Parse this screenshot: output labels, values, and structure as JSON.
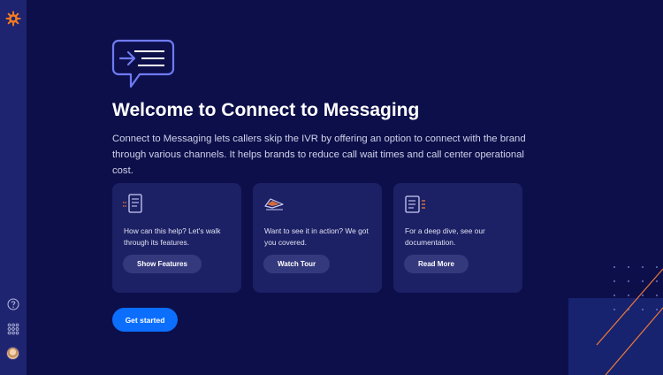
{
  "sidebar": {
    "logo_icon": "sun-gear-logo",
    "help_icon": "question-circle-icon",
    "apps_icon": "app-grid-icon",
    "avatar": "user-avatar"
  },
  "hero": {
    "icon": "chat-arrow-icon",
    "title": "Welcome to Connect to Messaging",
    "description": "Connect to Messaging lets callers skip the IVR by offering an option to connect with the brand through various channels. It helps brands to reduce call wait times and call center operational cost."
  },
  "cards": [
    {
      "icon": "feature-list-icon",
      "text": "How can this help? Let's walk through its features.",
      "button": "Show Features"
    },
    {
      "icon": "tour-icon",
      "text": "Want to see it in action? We got you covered.",
      "button": "Watch Tour"
    },
    {
      "icon": "document-icon",
      "text": "For a deep dive, see our documentation.",
      "button": "Read More"
    }
  ],
  "cta": {
    "label": "Get started"
  },
  "colors": {
    "background": "#0d0f4a",
    "sidebar": "#1f2470",
    "card": "#1c2064",
    "primary": "#0b6efd",
    "accent_orange": "#f07a3a"
  }
}
